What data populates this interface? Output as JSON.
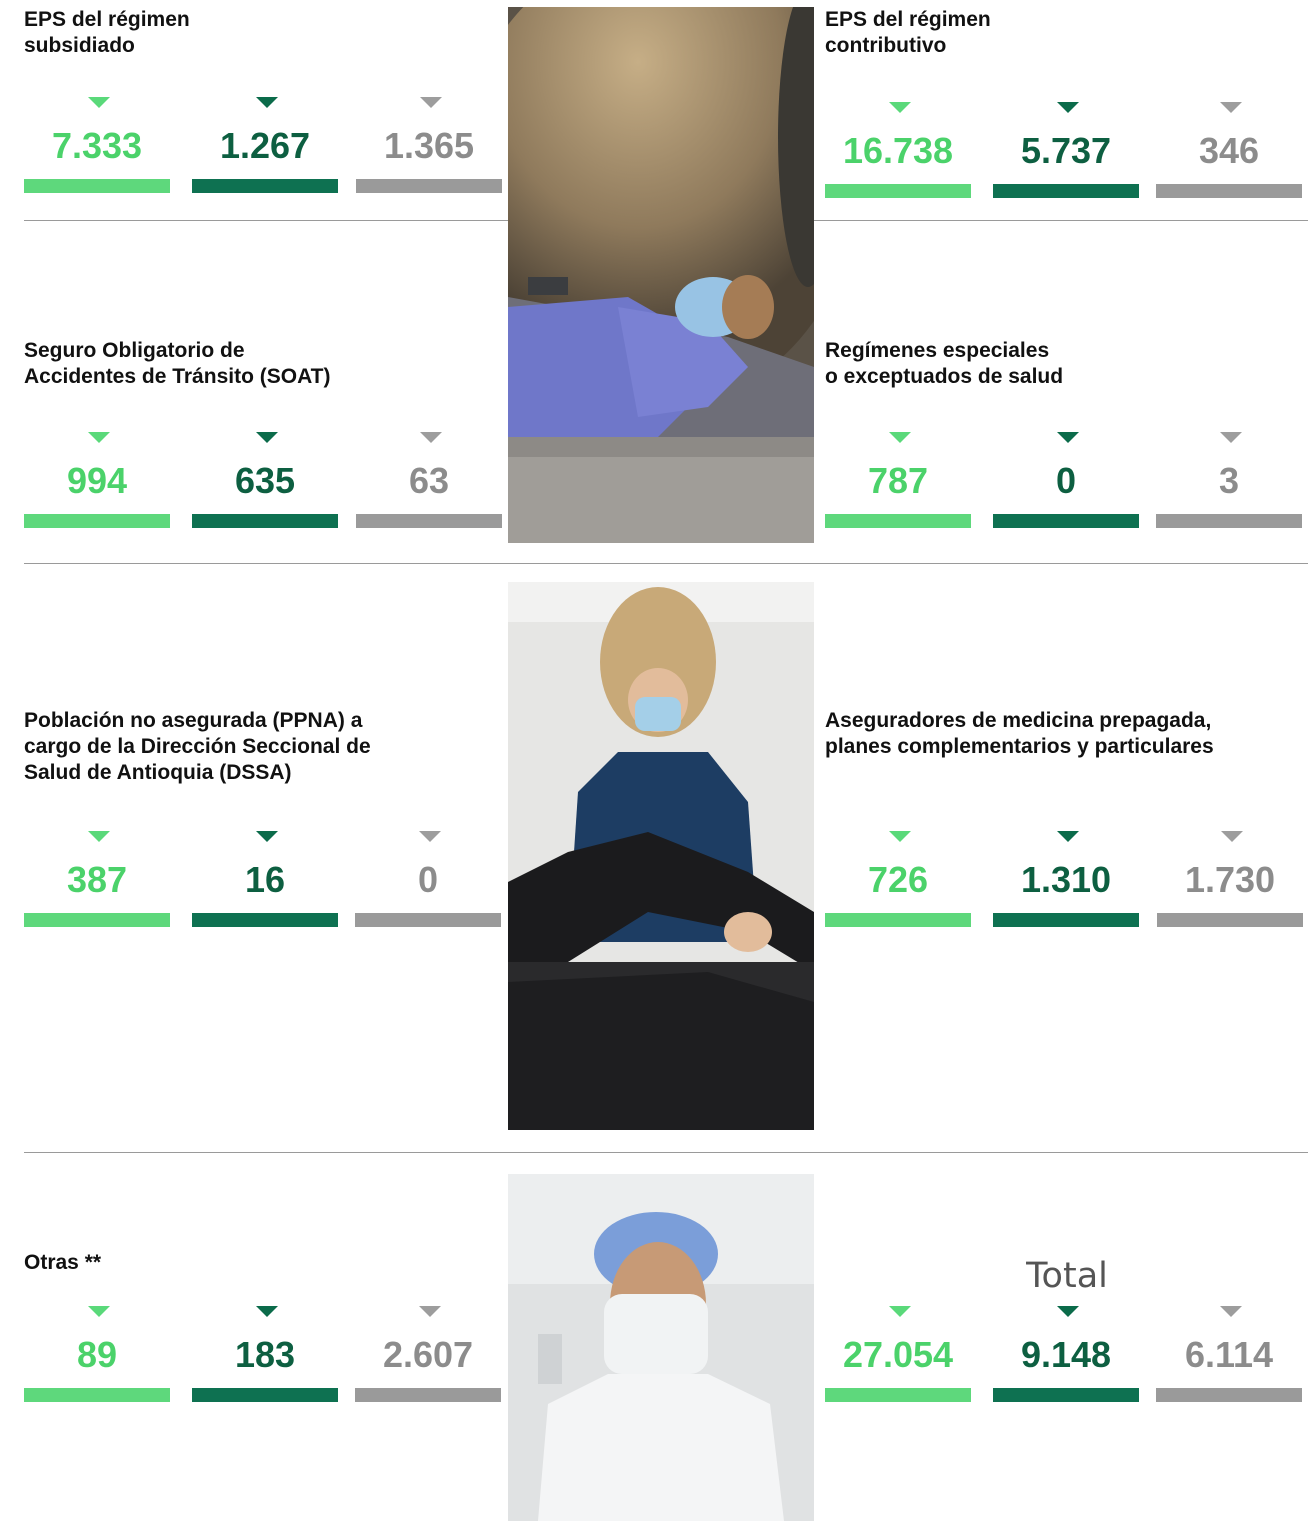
{
  "sections": [
    {
      "left": {
        "title": "EPS del régimen\nsubsidiado",
        "values": [
          "7.333",
          "1.267",
          "1.365"
        ]
      },
      "right": {
        "title": "EPS del régimen\ncontributivo",
        "values": [
          "16.738",
          "5.737",
          "346"
        ]
      }
    },
    {
      "left": {
        "title": "Seguro Obligatorio de\nAccidentes de Tránsito (SOAT)",
        "values": [
          "994",
          "635",
          "63"
        ]
      },
      "right": {
        "title": "Regímenes especiales\no exceptuados de salud",
        "values": [
          "787",
          "0",
          "3"
        ]
      }
    },
    {
      "left": {
        "title": "Población no asegurada (PPNA) a\ncargo de la Dirección Seccional de\nSalud de Antioquia (DSSA)",
        "values": [
          "387",
          "16",
          "0"
        ]
      },
      "right": {
        "title": "Aseguradores de medicina prepagada,\nplanes complementarios y particulares",
        "values": [
          "726",
          "1.310",
          "1.730"
        ]
      }
    },
    {
      "left": {
        "title": "Otras **",
        "values": [
          "89",
          "183",
          "2.607"
        ]
      },
      "right": {
        "title": "Total",
        "values": [
          "27.054",
          "9.148",
          "6.114"
        ]
      }
    }
  ],
  "colors": {
    "light_green": "#5ed87c",
    "dark_green": "#0e7151",
    "gray": "#9a9a9a"
  },
  "icons": [
    "triangle-down-icon"
  ]
}
